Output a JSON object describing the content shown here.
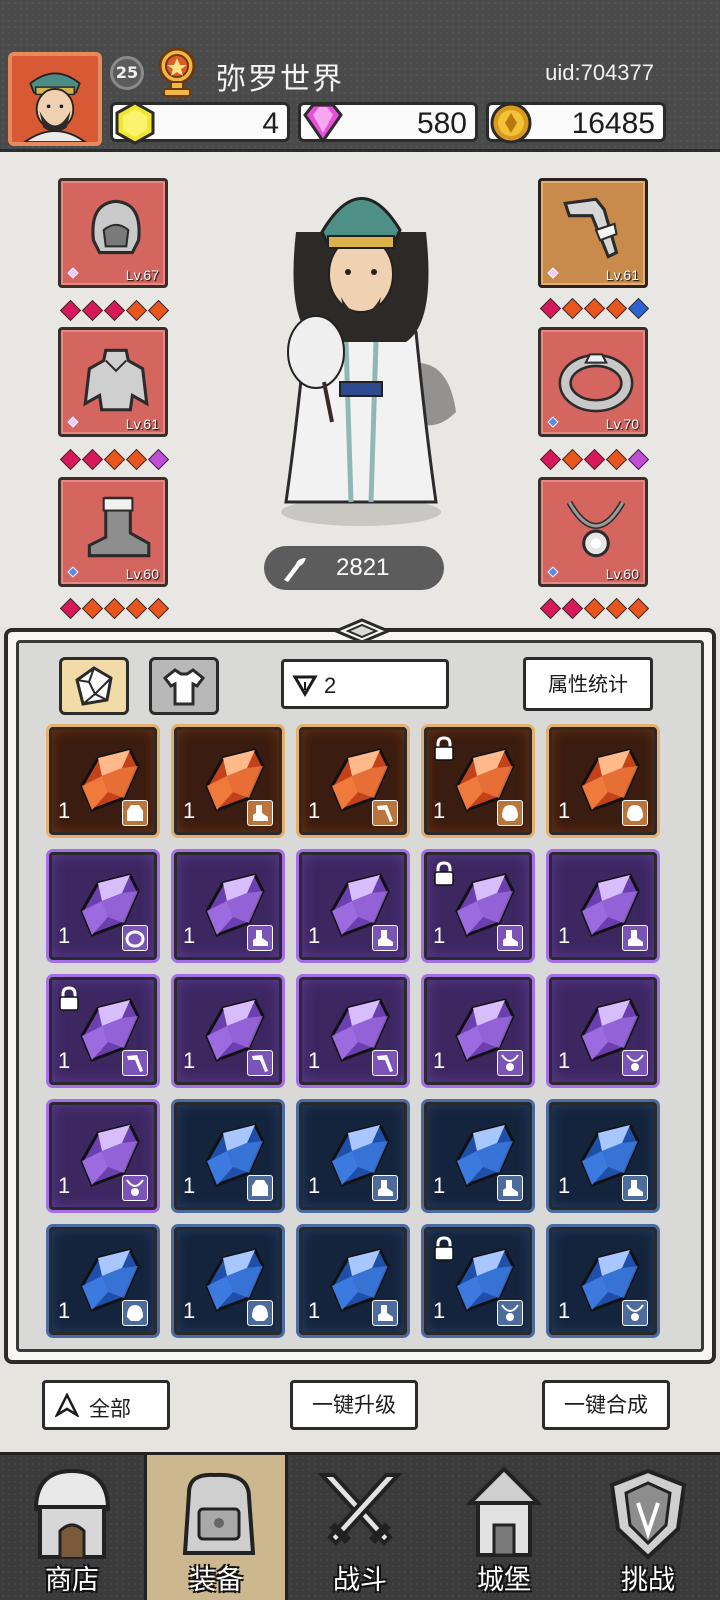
{
  "header": {
    "level": "25",
    "player_name": "弥罗世界",
    "uid": "uid:704377",
    "currencies": {
      "gem": "4",
      "diamond": "580",
      "coin": "16485"
    }
  },
  "equipment": {
    "left": [
      {
        "slot": "helmet",
        "level": "Lv.67",
        "stars": [
          "#d7185a",
          "#d7185a",
          "#d7185a",
          "#e9561d",
          "#e9561d"
        ]
      },
      {
        "slot": "cape",
        "level": "Lv.61",
        "stars": [
          "#d7185a",
          "#d7185a",
          "#e9561d",
          "#e9561d",
          "#c04cd8"
        ]
      },
      {
        "slot": "boots",
        "level": "Lv.60",
        "stars": [
          "#d7185a",
          "#e9561d",
          "#e9561d",
          "#e9561d",
          "#e9561d"
        ]
      }
    ],
    "right": [
      {
        "slot": "weapon",
        "level": "Lv.61",
        "stars": [
          "#d7185a",
          "#e9561d",
          "#e9561d",
          "#e9561d",
          "#2a64d2"
        ]
      },
      {
        "slot": "ring",
        "level": "Lv.70",
        "stars": [
          "#d7185a",
          "#e9561d",
          "#d7185a",
          "#e9561d",
          "#c04cd8"
        ]
      },
      {
        "slot": "necklace",
        "level": "Lv.60",
        "stars": [
          "#d7185a",
          "#d7185a",
          "#e9561d",
          "#e9561d",
          "#e9561d"
        ]
      }
    ],
    "power": "2821"
  },
  "inventory": {
    "sort_value": "2",
    "stats_button": "属性统计",
    "items": [
      {
        "rarity": "orange",
        "count": "1",
        "slot": "cape",
        "locked": false
      },
      {
        "rarity": "orange",
        "count": "1",
        "slot": "boots",
        "locked": false
      },
      {
        "rarity": "orange",
        "count": "1",
        "slot": "weapon",
        "locked": false
      },
      {
        "rarity": "orange",
        "count": "1",
        "slot": "helmet",
        "locked": true
      },
      {
        "rarity": "orange",
        "count": "1",
        "slot": "helmet",
        "locked": false
      },
      {
        "rarity": "purple",
        "count": "1",
        "slot": "ring",
        "locked": false
      },
      {
        "rarity": "purple",
        "count": "1",
        "slot": "boots",
        "locked": false
      },
      {
        "rarity": "purple",
        "count": "1",
        "slot": "boots",
        "locked": false
      },
      {
        "rarity": "purple",
        "count": "1",
        "slot": "boots",
        "locked": true
      },
      {
        "rarity": "purple",
        "count": "1",
        "slot": "boots",
        "locked": false
      },
      {
        "rarity": "purple",
        "count": "1",
        "slot": "weapon",
        "locked": true
      },
      {
        "rarity": "purple",
        "count": "1",
        "slot": "weapon",
        "locked": false
      },
      {
        "rarity": "purple",
        "count": "1",
        "slot": "weapon",
        "locked": false
      },
      {
        "rarity": "purple",
        "count": "1",
        "slot": "necklace",
        "locked": false
      },
      {
        "rarity": "purple",
        "count": "1",
        "slot": "necklace",
        "locked": false
      },
      {
        "rarity": "purple",
        "count": "1",
        "slot": "necklace",
        "locked": false
      },
      {
        "rarity": "blue",
        "count": "1",
        "slot": "cape",
        "locked": false
      },
      {
        "rarity": "blue",
        "count": "1",
        "slot": "boots",
        "locked": false
      },
      {
        "rarity": "blue",
        "count": "1",
        "slot": "boots",
        "locked": false
      },
      {
        "rarity": "blue",
        "count": "1",
        "slot": "boots",
        "locked": false
      },
      {
        "rarity": "blue",
        "count": "1",
        "slot": "helmet",
        "locked": false
      },
      {
        "rarity": "blue",
        "count": "1",
        "slot": "helmet",
        "locked": false
      },
      {
        "rarity": "blue",
        "count": "1",
        "slot": "boots",
        "locked": false
      },
      {
        "rarity": "blue",
        "count": "1",
        "slot": "necklace",
        "locked": true
      },
      {
        "rarity": "blue",
        "count": "1",
        "slot": "necklace",
        "locked": false
      }
    ]
  },
  "actions": {
    "filter_all": "全部",
    "one_key_upgrade": "一键升级",
    "one_key_merge": "一键合成"
  },
  "nav": [
    {
      "label": "商店",
      "icon": "shop-icon",
      "active": false
    },
    {
      "label": "装备",
      "icon": "backpack-icon",
      "active": true
    },
    {
      "label": "战斗",
      "icon": "crossed-swords-icon",
      "active": false
    },
    {
      "label": "城堡",
      "icon": "castle-icon",
      "active": false
    },
    {
      "label": "挑战",
      "icon": "shield-crest-icon",
      "active": false
    }
  ]
}
